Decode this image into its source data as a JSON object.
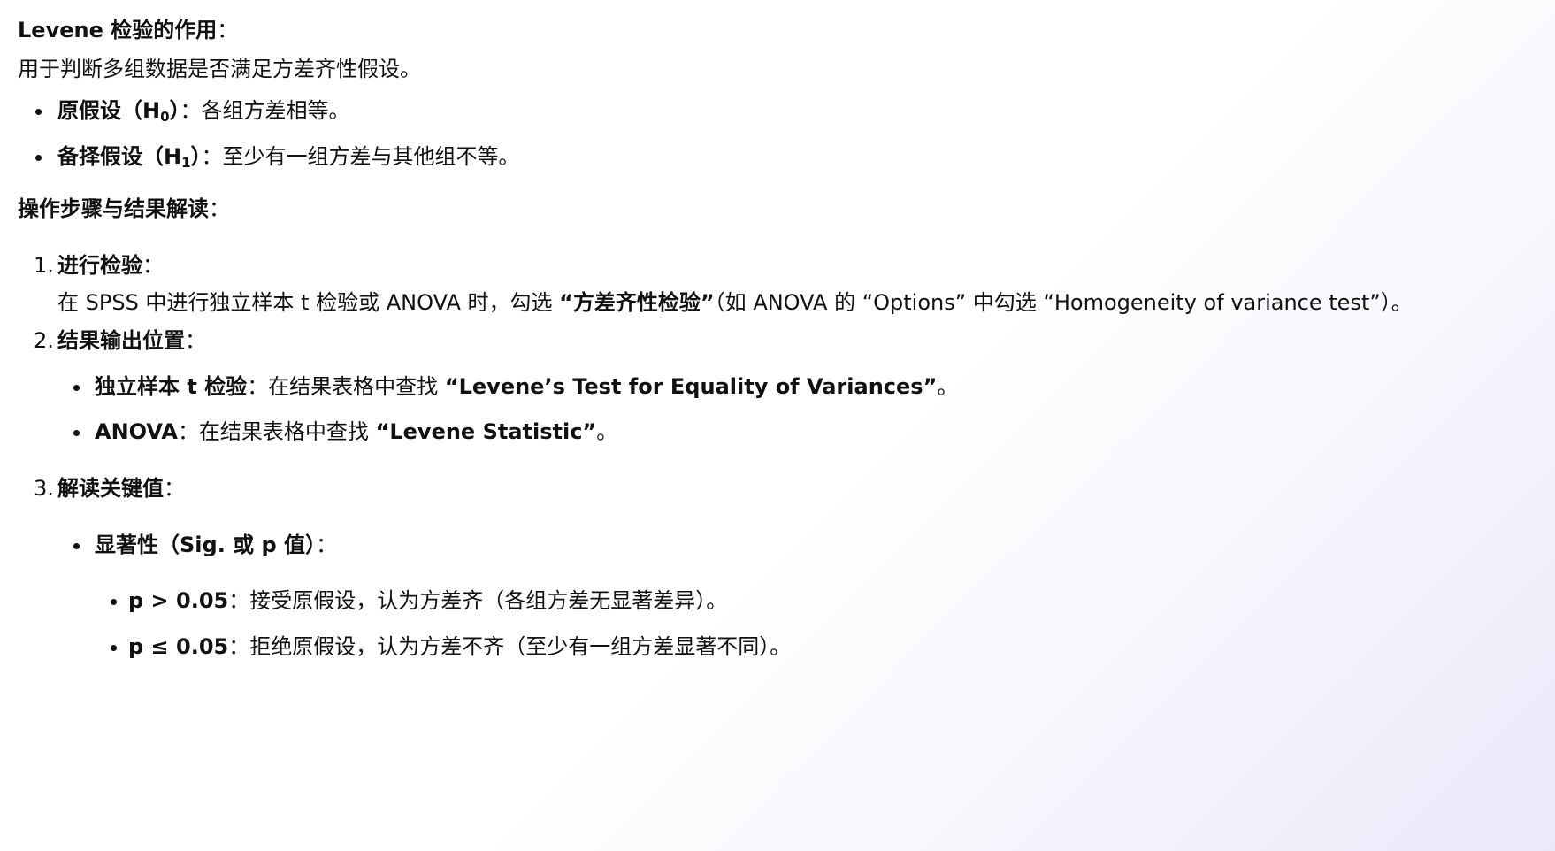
{
  "intro": {
    "title": "Levene 检验的作用",
    "colon": "：",
    "text": "用于判断多组数据是否满足方差齐性假设。"
  },
  "hypotheses": [
    {
      "label": "原假设（H",
      "sub": "0",
      "label_end": "）",
      "text": "：各组方差相等。"
    },
    {
      "label": "备择假设（H",
      "sub": "1",
      "label_end": "）",
      "text": "：至少有一组方差与其他组不等。"
    }
  ],
  "section": {
    "title": "操作步骤与结果解读",
    "colon": "："
  },
  "steps": {
    "step1": {
      "num": "1.",
      "title": "进行检验",
      "colon": "：",
      "desc_pre": "在 SPSS 中进行独立样本 t 检验或 ANOVA 时，勾选 ",
      "desc_bold": "“方差齐性检验”",
      "desc_post": "（如 ANOVA 的 “Options” 中勾选 “Homogeneity of variance test”）。"
    },
    "step2": {
      "num": "2.",
      "title": "结果输出位置",
      "colon": "：",
      "items": [
        {
          "bold": "独立样本 t 检验",
          "text": "：在结果表格中查找 ",
          "bold2": "“Levene’s Test for Equality of Variances”",
          "end": "。"
        },
        {
          "bold": "ANOVA",
          "text": "：在结果表格中查找 ",
          "bold2": "“Levene Statistic”",
          "end": "。"
        }
      ]
    },
    "step3": {
      "num": "3.",
      "title": "解读关键值",
      "colon": "：",
      "significance": {
        "label": "显著性（Sig. 或 p 值）",
        "colon": "："
      },
      "rules": [
        {
          "bold": "p > 0.05",
          "text": "：接受原假设，认为方差齐（各组方差无显著差异）。"
        },
        {
          "bold": "p ≤ 0.05",
          "text": "：拒绝原假设，认为方差不齐（至少有一组方差显著不同）。"
        }
      ]
    }
  }
}
